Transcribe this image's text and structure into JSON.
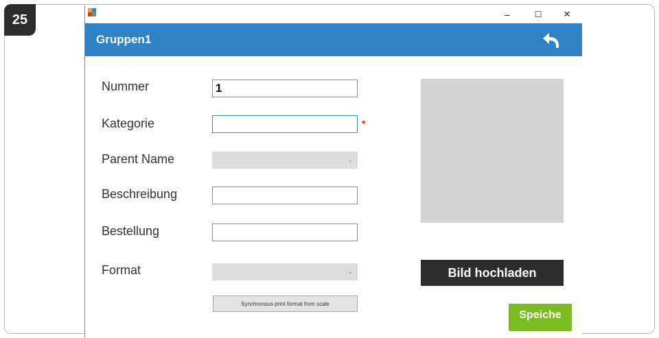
{
  "step_number": "25",
  "window": {
    "minimize_glyph": "–",
    "maximize_glyph": "☐",
    "close_glyph": "✕"
  },
  "header": {
    "title": "Gruppen1",
    "back_icon": "undo-arrow-icon"
  },
  "form": {
    "nummer_label": "Nummer",
    "nummer_value": "1",
    "kategorie_label": "Kategorie",
    "kategorie_value": "",
    "required_marker": "*",
    "parent_label": "Parent Name",
    "beschreibung_label": "Beschreibung",
    "beschreibung_value": "",
    "bestellung_label": "Bestellung",
    "bestellung_value": "",
    "format_label": "Format",
    "sync_button_label": "Synchronous print format from scale"
  },
  "image_panel": {
    "upload_label": "Bild hochladen"
  },
  "save_label": "Speiche",
  "colors": {
    "header_blue": "#2e83c6",
    "save_green": "#7dbb23",
    "upload_dark": "#2d2d2d",
    "required_red": "#e02020"
  }
}
